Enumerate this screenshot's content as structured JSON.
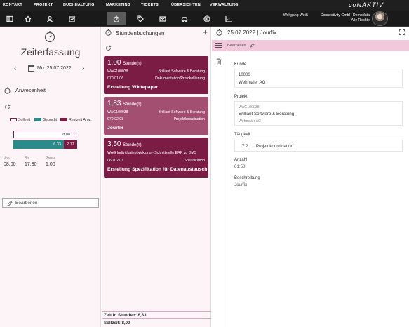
{
  "topmenu": [
    "KONTAKT",
    "PROJEKT",
    "BUCHHALTUNG",
    "MARKETING",
    "TICKETS",
    "ÜBERSICHTEN",
    "VERWALTUNG"
  ],
  "brand": "coNAKTIV",
  "iconbar": [
    "sidebar-toggle-icon",
    "home-icon",
    "person-icon",
    "task-icon",
    "stopwatch-icon",
    "tag-icon",
    "mail-icon",
    "car-icon",
    "euro-icon",
    "chart-icon"
  ],
  "user": {
    "name": "Wolfgang Weiß",
    "company": "Connectivity GmbH-Demodata",
    "rights": "Alle Rechte"
  },
  "left": {
    "title": "Zeiterfassung",
    "date": "Mo. 25.07.2022",
    "section": "Anwesenheit",
    "legend": {
      "soll": "Sollzeit",
      "gebucht": "Gebucht",
      "rest": "Restzeit Anw."
    },
    "colors": {
      "gebucht": "#2b8a8a",
      "rest": "#7b1c45"
    },
    "soll_value": "8.00",
    "gebucht_value": "6.33",
    "rest_value": "2.17",
    "von_label": "Von",
    "bis_label": "Bis",
    "pause_label": "Pause",
    "von": "08:00",
    "bis": "17:30",
    "pause": "1,00",
    "edit_label": "Bearbeiten"
  },
  "mid": {
    "title": "Stundenbuchungen",
    "cards": [
      {
        "hours": "1,00",
        "unit": "Stunde(n)",
        "code": "WAG100038",
        "client": "Brilliant Software & Beratung",
        "task_no": "070.01.06",
        "task": "Dokumentation/Protokollierung",
        "name": "Erstellung Whitepaper"
      },
      {
        "hours": "1,83",
        "unit": "Stunde(n)",
        "code": "WAG100038",
        "client": "Brilliant Software & Beratung",
        "task_no": "070.02.08",
        "task": "Projektkoordination",
        "name": "Jourfix"
      },
      {
        "hours": "3,50",
        "unit": "Stunde(n)",
        "code": "WAG Individualentwicklung - Schnittstelle ERP zu DMS",
        "client": "",
        "task_no": "060.02.01",
        "task": "Spezifikation",
        "name": "Erstellung Spezifikation für Datenaustausch"
      }
    ],
    "footer_booked": "Zeit in Stunden: 6,33",
    "footer_target": "Sollzeit: 8,00"
  },
  "right": {
    "title": "25.07.2022 | Jourfix",
    "edit_label": "Bearbeiten",
    "kunde_label": "Kunde",
    "kunde_no": "10000",
    "kunde_name": "Wehmaier AG",
    "projekt_label": "Projekt",
    "projekt_code": "WAG100038",
    "projekt_name": "Brilliant Software & Beratung",
    "projekt_sub": "Wehmaier AG",
    "taetigkeit_label": "Tätigkeit",
    "taetigkeit_no": "7.2",
    "taetigkeit_name": "Projektkoordination",
    "anzahl_label": "Anzahl",
    "anzahl": "01:50",
    "beschreibung_label": "Beschreibung",
    "beschreibung": "Jourfix"
  }
}
